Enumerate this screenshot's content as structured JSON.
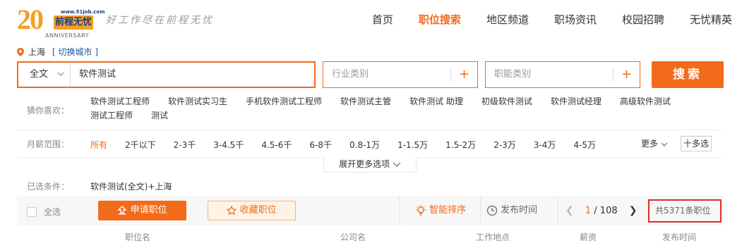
{
  "brand": {
    "logo_number": "20",
    "logo_url": "www.51job.com",
    "logo_name": "前程无忧",
    "logo_anniversary": "ANNIVERSARY",
    "slogan": "好工作尽在前程无忧"
  },
  "nav": {
    "items": [
      {
        "label": "首页"
      },
      {
        "label": "职位搜索",
        "active": true
      },
      {
        "label": "地区频道"
      },
      {
        "label": "职场资讯"
      },
      {
        "label": "校园招聘"
      },
      {
        "label": "无忧精英"
      }
    ]
  },
  "location": {
    "city": "上海",
    "switch_label": "[ 切换城市 ]"
  },
  "search": {
    "scope": "全文",
    "keyword": "软件测试",
    "industry_placeholder": "行业类别",
    "function_placeholder": "职能类别",
    "plus": "+",
    "button": "搜索"
  },
  "guess": {
    "label": "猜你喜欢：",
    "tags": [
      "软件测试工程师",
      "软件测试实习生",
      "手机软件测试工程师",
      "软件测试主管",
      "软件测试 助理",
      "初级软件测试",
      "软件测试经理",
      "高级软件测试",
      "测试工程师",
      "测试"
    ]
  },
  "salary": {
    "label": "月薪范围：",
    "options": [
      "所有",
      "2千以下",
      "2-3千",
      "3-4.5千",
      "4.5-6千",
      "6-8千",
      "0.8-1万",
      "1-1.5万",
      "1.5-2万",
      "2-3万",
      "3-4万",
      "4-5万"
    ],
    "more": "更多",
    "multi": "十多选",
    "expand": "展开更多选项"
  },
  "selected": {
    "label": "已选条件：",
    "value": "软件测试(全文)+上海"
  },
  "toolbar": {
    "select_all": "全选",
    "apply": "申请职位",
    "collect": "收藏职位",
    "smart_sort": "智能排序",
    "time_sort": "发布时间",
    "page_current": "1",
    "page_total": "/ 108",
    "total": "共5371条职位"
  },
  "columns": [
    "职位名",
    "公司名",
    "工作地点",
    "薪资",
    "发布时间"
  ],
  "colors": {
    "accent": "#f26b1a",
    "highlight_border": "#e02b2b",
    "link": "#1a56a8"
  }
}
